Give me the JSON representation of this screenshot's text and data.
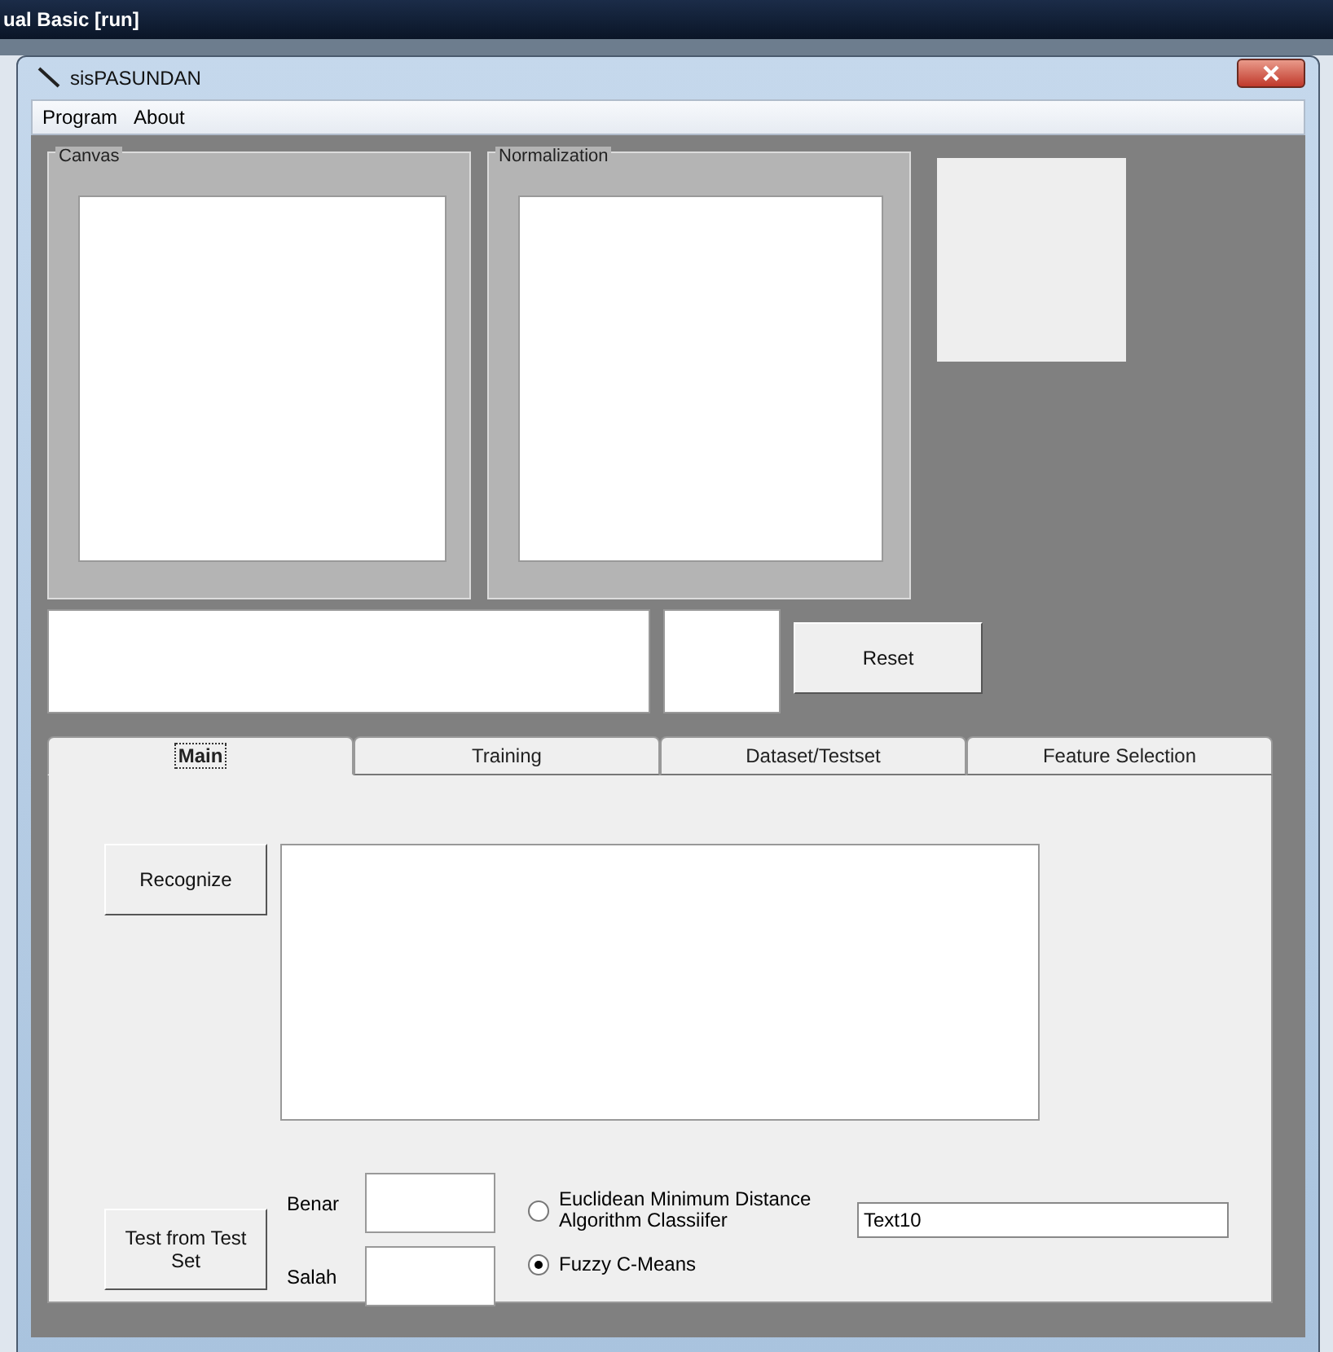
{
  "ide": {
    "title": "ual Basic [run]"
  },
  "window": {
    "title": "sisPASUNDAN"
  },
  "menu": [
    {
      "label": "Program"
    },
    {
      "label": "About"
    }
  ],
  "frames": [
    {
      "title": "Canvas"
    },
    {
      "title": "Normalization"
    }
  ],
  "reset_button": "Reset",
  "tabs": [
    {
      "label": "Main",
      "selected": true
    },
    {
      "label": "Training",
      "selected": false
    },
    {
      "label": "Dataset/Testset",
      "selected": false
    },
    {
      "label": "Feature Selection",
      "selected": false
    }
  ],
  "main": {
    "recognize_button": "Recognize",
    "test_button": "Test from Test Set",
    "benar_label": "Benar",
    "salah_label": "Salah",
    "classifiers": [
      {
        "label": "Euclidean Minimum Distance Algorithm Classiifer",
        "selected": false
      },
      {
        "label": "Fuzzy C-Means",
        "selected": true
      }
    ],
    "text_field": "Text10"
  }
}
